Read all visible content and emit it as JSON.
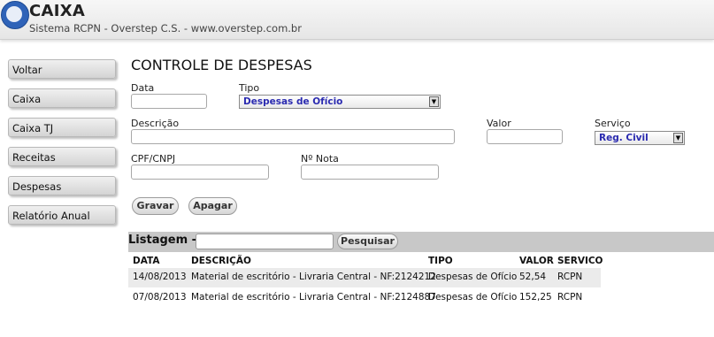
{
  "header": {
    "brand": "CAIXA",
    "subtitle": "Sistema RCPN - Overstep C.S. - www.overstep.com.br"
  },
  "sidebar": {
    "items": [
      {
        "label": "Voltar"
      },
      {
        "label": "Caixa"
      },
      {
        "label": "Caixa TJ"
      },
      {
        "label": "Receitas"
      },
      {
        "label": "Despesas"
      },
      {
        "label": "Relatório Anual"
      }
    ]
  },
  "form": {
    "title": "CONTROLE DE DESPESAS",
    "data_label": "Data",
    "data_value": "",
    "tipo_label": "Tipo",
    "tipo_value": "Despesas de Ofício",
    "descricao_label": "Descrição",
    "descricao_value": "",
    "valor_label": "Valor",
    "valor_value": "",
    "servico_label": "Serviço",
    "servico_value": "Reg. Civil",
    "cpf_label": "CPF/CNPJ",
    "cpf_value": "",
    "nota_label": "Nº Nota",
    "nota_value": "",
    "gravar_label": "Gravar",
    "apagar_label": "Apagar"
  },
  "listing": {
    "title": "Listagem -",
    "search_value": "",
    "search_button": "Pesquisar",
    "columns": [
      "DATA",
      "DESCRIÇÃO",
      "TIPO",
      "VALOR",
      "SERVICO"
    ],
    "rows": [
      [
        "14/08/2013",
        "Material de escritório - Livraria Central - NF:2124212",
        "Despesas de Ofício",
        "52,54",
        "RCPN"
      ],
      [
        "07/08/2013",
        "Material de escritório - Livraria Central - NF:2124887",
        "Despesas de Ofício",
        "152,25",
        "RCPN"
      ]
    ]
  }
}
